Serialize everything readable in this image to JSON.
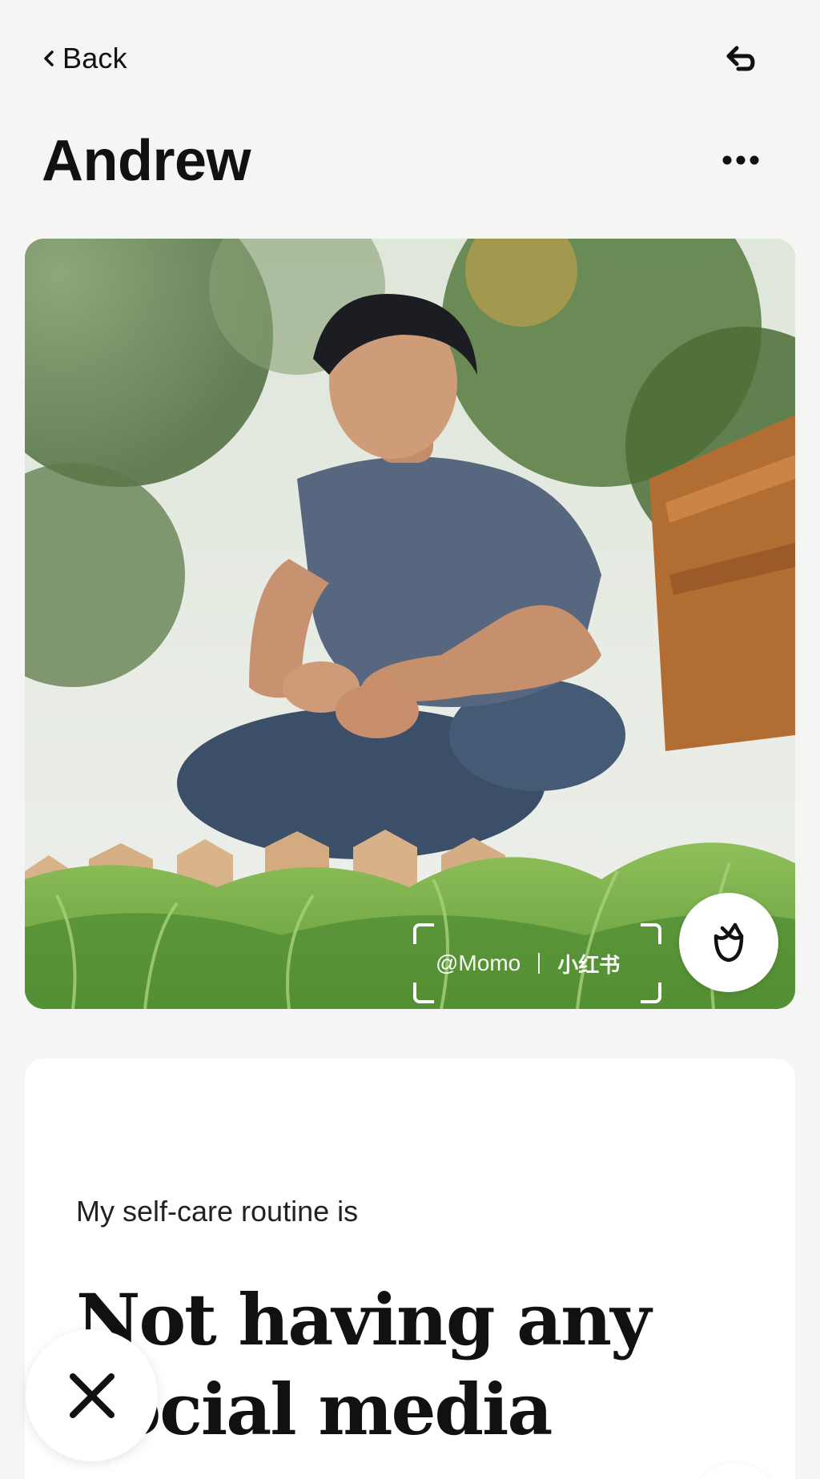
{
  "nav": {
    "back_label": "Back",
    "back_icon": "chevron-left-icon",
    "undo_icon": "undo-arrow-icon"
  },
  "profile": {
    "name": "Andrew",
    "more_icon": "more-horizontal-icon"
  },
  "photo": {
    "description_icon": "profile-photo",
    "watermark_handle": "@Momo",
    "watermark_brand": "小红书",
    "rose_icon": "rose-icon"
  },
  "prompt": {
    "label": "My self-care routine is",
    "answer": "Not having any social media"
  },
  "actions": {
    "skip_icon": "close-x-icon",
    "like_icon": "heart-icon"
  },
  "colors": {
    "background": "#f5f5f4",
    "card": "#ffffff",
    "text": "#111111"
  }
}
